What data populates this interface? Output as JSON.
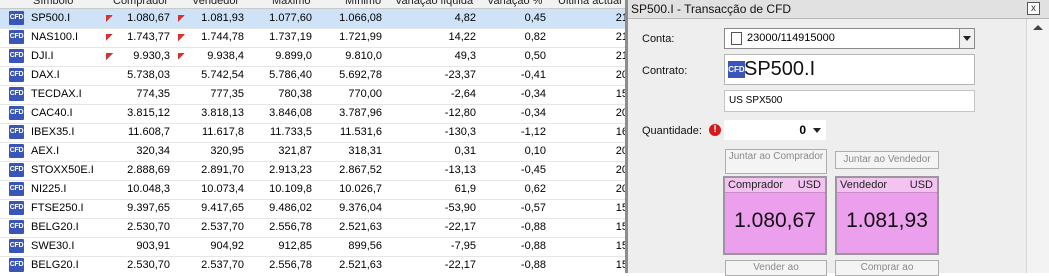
{
  "table": {
    "headers": {
      "name": "Símbolo",
      "buy": "Comprador",
      "sell": "Vendedor",
      "max": "Máximo",
      "min": "Mínimo",
      "var": "Variação líquida",
      "pct": "Variação %",
      "last": "Última actual"
    },
    "icon_label": "CFD",
    "rows": [
      {
        "name": "SP500.I",
        "buy": "1.080,67",
        "sell": "1.081,93",
        "max": "1.077,60",
        "min": "1.066,08",
        "var": "4,82",
        "pct": "0,45",
        "last": "21",
        "arrow": "up",
        "selected": true
      },
      {
        "name": "NAS100.I",
        "buy": "1.743,77",
        "sell": "1.744,78",
        "max": "1.737,19",
        "min": "1.721,99",
        "var": "14,22",
        "pct": "0,82",
        "last": "21",
        "arrow": "up"
      },
      {
        "name": "DJI.I",
        "buy": "9.930,3",
        "sell": "9.938,4",
        "max": "9.899,0",
        "min": "9.810,0",
        "var": "49,3",
        "pct": "0,50",
        "last": "21",
        "arrow": "up"
      },
      {
        "name": "DAX.I",
        "buy": "5.738,03",
        "sell": "5.742,54",
        "max": "5.786,40",
        "min": "5.692,78",
        "var": "-23,37",
        "pct": "-0,41",
        "last": "20"
      },
      {
        "name": "TECDAX.I",
        "buy": "774,35",
        "sell": "777,35",
        "max": "780,38",
        "min": "770,00",
        "var": "-2,64",
        "pct": "-0,34",
        "last": "15"
      },
      {
        "name": "CAC40.I",
        "buy": "3.815,12",
        "sell": "3.818,13",
        "max": "3.846,08",
        "min": "3.787,96",
        "var": "-12,80",
        "pct": "-0,34",
        "last": "20"
      },
      {
        "name": "IBEX35.I",
        "buy": "11.608,7",
        "sell": "11.617,8",
        "max": "11.733,5",
        "min": "11.531,6",
        "var": "-130,3",
        "pct": "-1,12",
        "last": "16"
      },
      {
        "name": "AEX.I",
        "buy": "320,34",
        "sell": "320,95",
        "max": "321,87",
        "min": "318,31",
        "var": "0,31",
        "pct": "0,10",
        "last": "20"
      },
      {
        "name": "STOXX50E.I",
        "buy": "2.888,69",
        "sell": "2.891,70",
        "max": "2.913,23",
        "min": "2.867,52",
        "var": "-13,13",
        "pct": "-0,45",
        "last": "20"
      },
      {
        "name": "NI225.I",
        "buy": "10.048,3",
        "sell": "10.073,4",
        "max": "10.109,8",
        "min": "10.026,7",
        "var": "61,9",
        "pct": "0,62",
        "last": "20"
      },
      {
        "name": "FTSE250.I",
        "buy": "9.397,65",
        "sell": "9.417,65",
        "max": "9.486,02",
        "min": "9.376,04",
        "var": "-53,90",
        "pct": "-0,57",
        "last": "15"
      },
      {
        "name": "BELG20.I",
        "buy": "2.530,70",
        "sell": "2.537,70",
        "max": "2.556,78",
        "min": "2.521,63",
        "var": "-22,17",
        "pct": "-0,88",
        "last": "15"
      },
      {
        "name": "SWE30.I",
        "buy": "903,91",
        "sell": "904,92",
        "max": "912,85",
        "min": "899,56",
        "var": "-7,95",
        "pct": "-0,88",
        "last": "15"
      },
      {
        "name": "BELG20.I",
        "buy": "2.530,70",
        "sell": "2.537,70",
        "max": "2.556,78",
        "min": "2.521,63",
        "var": "-22,17",
        "pct": "-0,88",
        "last": "15"
      }
    ]
  },
  "panel": {
    "title": "SP500.I - Transacção de CFD",
    "close_glyph": "x",
    "account_label": "Conta:",
    "account_value": "23000/114915000",
    "contract_label": "Contrato:",
    "contract_icon": "CFD",
    "contract_symbol": "SP500.I",
    "contract_desc": "US SPX500",
    "quantity_label": "Quantidade:",
    "warning_glyph": "!",
    "quantity_value": "0",
    "join_buyer": "Juntar ao Comprador",
    "join_seller": "Juntar ao Vendedor",
    "buyer_tile": {
      "label": "Comprador",
      "currency": "USD",
      "price": "1.080,67"
    },
    "seller_tile": {
      "label": "Vendedor",
      "currency": "USD",
      "price": "1.081,93"
    },
    "sell_to": "Vender ao",
    "buy_from": "Comprar ao",
    "colors": {
      "selected_row": "#cfe3f8",
      "price_tile": "#ec9fec",
      "cfd_icon": "#3a55b8",
      "warning": "#d41a1a"
    }
  }
}
